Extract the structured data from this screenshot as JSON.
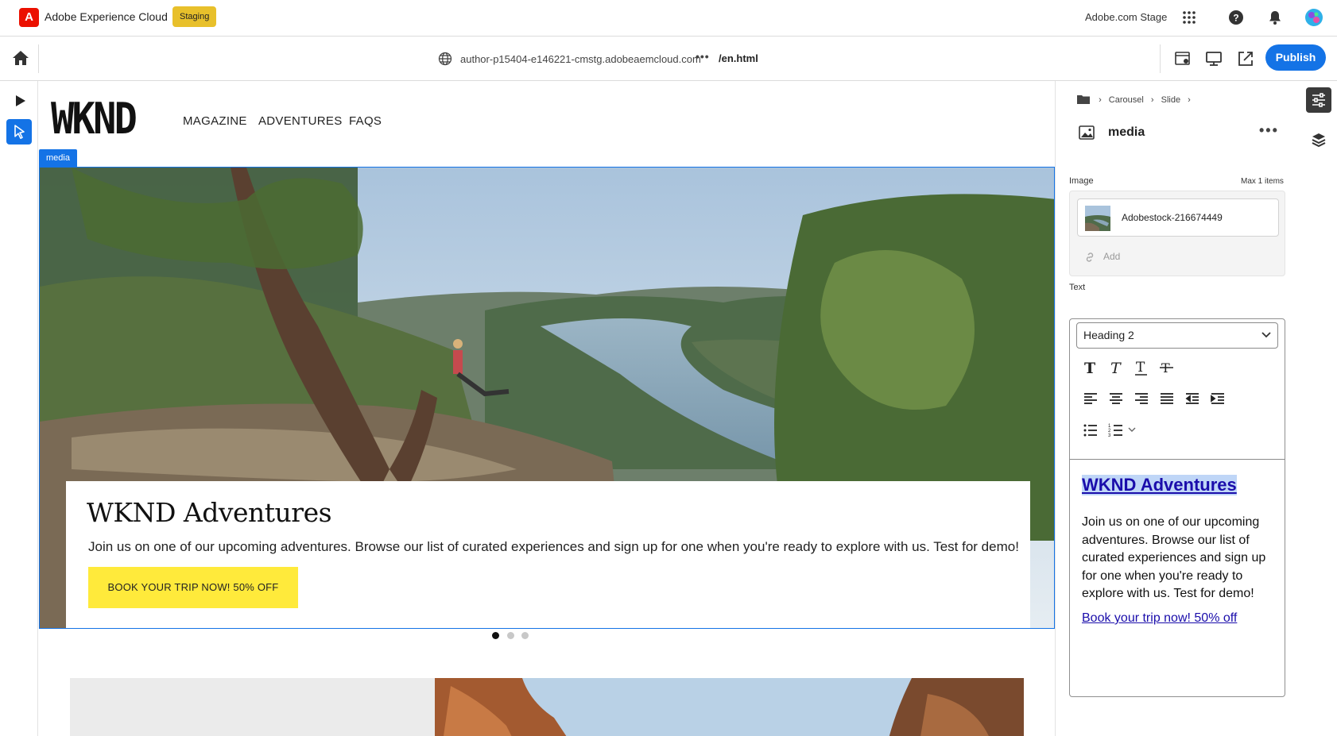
{
  "topbar": {
    "brand": "Adobe Experience Cloud",
    "badge": "Staging",
    "environment": "Adobe.com Stage"
  },
  "toolbar": {
    "url": "author-p15404-e146221-cmstg.adobeaemcloud.com",
    "more": "•••",
    "path": "/en.html",
    "publish_label": "Publish"
  },
  "site": {
    "logo": "WKND",
    "nav": [
      "MAGAZINE",
      "ADVENTURES",
      "FAQS"
    ],
    "selected_component_tag": "media",
    "hero": {
      "title": "WKND Adventures",
      "description": "Join us on one of our upcoming adventures. Browse our list of curated experiences and sign up for one when you're ready to explore with us. Test for demo!",
      "cta": "BOOK YOUR TRIP NOW! 50% OFF"
    },
    "carousel_active_index": 1,
    "carousel_count": 3
  },
  "panel": {
    "breadcrumb": [
      "Carousel",
      "Slide"
    ],
    "title": "media",
    "image_label": "Image",
    "image_limit": "Max 1 items",
    "image_name": "Adobestock-216674449",
    "add_label": "Add",
    "text_label": "Text",
    "block_format": "Heading 2",
    "rte_heading": "WKND Adventures",
    "rte_paragraph": "Join us on one of our upcoming adventures. Browse our list of curated experiences and sign up for one when you're ready to explore with us. Test for demo!",
    "rte_link": "Book your trip now! 50% off"
  },
  "colors": {
    "accent": "#1473e6",
    "badge": "#e8c02b",
    "cta": "#ffea3b",
    "adobe_red": "#eb1000"
  }
}
